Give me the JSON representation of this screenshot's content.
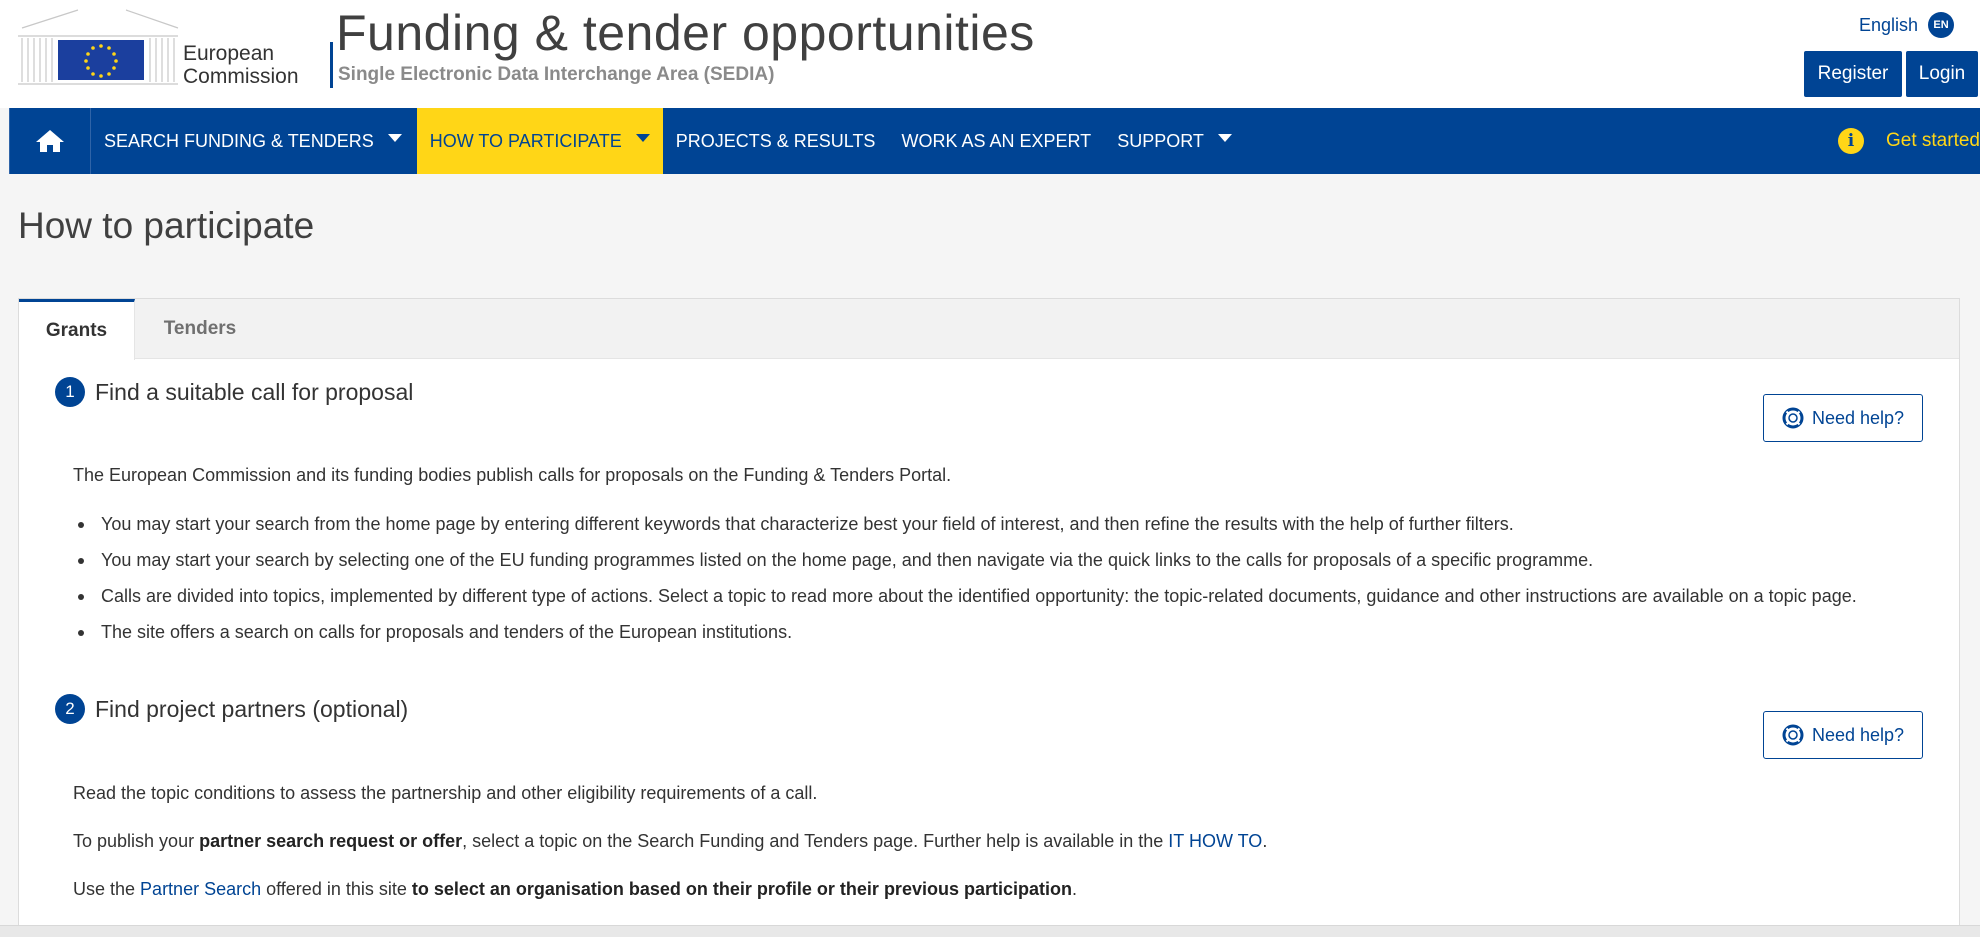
{
  "header": {
    "logo_line1": "European",
    "logo_line2": "Commission",
    "title": "Funding & tender opportunities",
    "subtitle": "Single Electronic Data Interchange Area (SEDIA)",
    "language": "English",
    "language_code": "EN",
    "register_label": "Register",
    "login_label": "Login"
  },
  "nav": {
    "items": [
      {
        "label": "SEARCH FUNDING & TENDERS",
        "dropdown": true
      },
      {
        "label": "HOW TO PARTICIPATE",
        "dropdown": true,
        "active": true
      },
      {
        "label": "PROJECTS & RESULTS"
      },
      {
        "label": "WORK AS AN EXPERT"
      },
      {
        "label": "SUPPORT",
        "dropdown": true
      }
    ],
    "get_started": "Get started"
  },
  "page": {
    "title": "How to participate"
  },
  "tabs": [
    {
      "label": "Grants",
      "active": true
    },
    {
      "label": "Tenders"
    }
  ],
  "steps": [
    {
      "number": "1",
      "title": "Find a suitable call for proposal",
      "help_label": "Need help?",
      "intro": "The European Commission and its funding bodies publish calls for proposals on the Funding & Tenders Portal.",
      "bullets": [
        "You may start your search from the home page by entering different keywords that characterize best your field of interest, and then refine the results with the help of further filters.",
        "You may start your search by selecting one of the EU funding programmes listed on the home page, and then navigate via the quick links to the calls for proposals of a specific programme.",
        "Calls are divided into topics, implemented by different type of actions. Select a topic to read more about the identified opportunity: the topic-related documents, guidance and other instructions are available on a topic page.",
        "The site offers a search on calls for proposals and tenders of the European institutions."
      ]
    },
    {
      "number": "2",
      "title": "Find project partners (optional)",
      "help_label": "Need help?",
      "p1": "Read the topic conditions to assess the partnership and other eligibility requirements of a call.",
      "p2_pre": "To publish your ",
      "p2_bold": "partner search request or offer",
      "p2_mid": ", select a topic on the Search Funding and Tenders page. Further help is available in the ",
      "p2_link": "IT HOW TO",
      "p2_post": ".",
      "p3_pre": "Use the ",
      "p3_link": "Partner Search",
      "p3_mid": " offered in this site ",
      "p3_bold": "to select an organisation based on their profile or their previous participation",
      "p3_post": "."
    }
  ],
  "colors": {
    "primary": "#004494",
    "accent": "#ffd617"
  }
}
